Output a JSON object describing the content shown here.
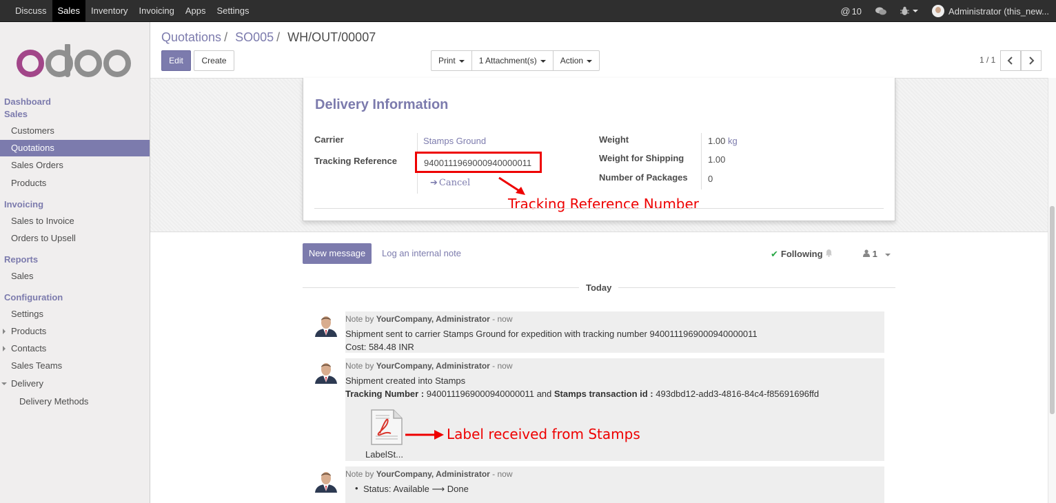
{
  "topbar": {
    "menu": [
      "Discuss",
      "Sales",
      "Inventory",
      "Invoicing",
      "Apps",
      "Settings"
    ],
    "active_menu": "Sales",
    "mentions_count": "10",
    "user_label": "Administrator (this_new..."
  },
  "sidebar": {
    "logo_text": "odoo",
    "sections": {
      "dashboard": "Dashboard",
      "sales": "Sales",
      "invoicing": "Invoicing",
      "reports": "Reports",
      "configuration": "Configuration"
    },
    "items": {
      "customers": "Customers",
      "quotations": "Quotations",
      "sales_orders": "Sales Orders",
      "products": "Products",
      "sales_to_invoice": "Sales to Invoice",
      "orders_to_upsell": "Orders to Upsell",
      "report_sales": "Sales",
      "settings": "Settings",
      "config_products": "Products",
      "contacts": "Contacts",
      "sales_teams": "Sales Teams",
      "delivery": "Delivery",
      "delivery_methods": "Delivery Methods"
    }
  },
  "breadcrumb": {
    "items": [
      "Quotations",
      "SO005"
    ],
    "current": "WH/OUT/00007",
    "separator": "/"
  },
  "toolbar": {
    "edit": "Edit",
    "create": "Create",
    "print": "Print",
    "attachments": "1 Attachment(s)",
    "action": "Action",
    "pager": "1 / 1"
  },
  "delivery": {
    "heading": "Delivery Information",
    "carrier_label": "Carrier",
    "carrier_value": "Stamps Ground",
    "tracking_label": "Tracking Reference",
    "tracking_value": "9400111969000940000011",
    "cancel": "Cancel",
    "weight_label": "Weight",
    "weight_value": "1.00",
    "weight_unit": "kg",
    "shipping_weight_label": "Weight for Shipping",
    "shipping_weight_value": "1.00",
    "packages_label": "Number of Packages",
    "packages_value": "0",
    "annotation": "Tracking Reference Number"
  },
  "chatter": {
    "new_message": "New message",
    "log_note": "Log an internal note",
    "following": "Following",
    "followers_count": "1",
    "today": "Today",
    "messages": [
      {
        "prefix": "Note by",
        "author": "YourCompany, Administrator",
        "time": "- now",
        "line1": "Shipment sent to carrier Stamps Ground for expedition with tracking number 9400111969000940000011",
        "line2": "Cost: 584.48 INR"
      },
      {
        "prefix": "Note by",
        "author": "YourCompany, Administrator",
        "time": "- now",
        "line1": "Shipment created into Stamps",
        "tracking_label": "Tracking Number :",
        "tracking_value": "9400111969000940000011",
        "and_text": "and",
        "txn_label": "Stamps transaction id :",
        "txn_value": "493dbd12-add3-4816-84c4-f85691696ffd",
        "attachment_name": "LabelSt...",
        "annotation": "Label received from Stamps"
      },
      {
        "prefix": "Note by",
        "author": "YourCompany, Administrator",
        "time": "- now",
        "status_label": "Status: Available",
        "status_arrow": "⟶",
        "status_new": "Done"
      }
    ]
  },
  "colors": {
    "brand": "#7c7bad",
    "topbar": "#2f2f2f",
    "annotation": "#e00000",
    "following_check": "#28a745"
  }
}
